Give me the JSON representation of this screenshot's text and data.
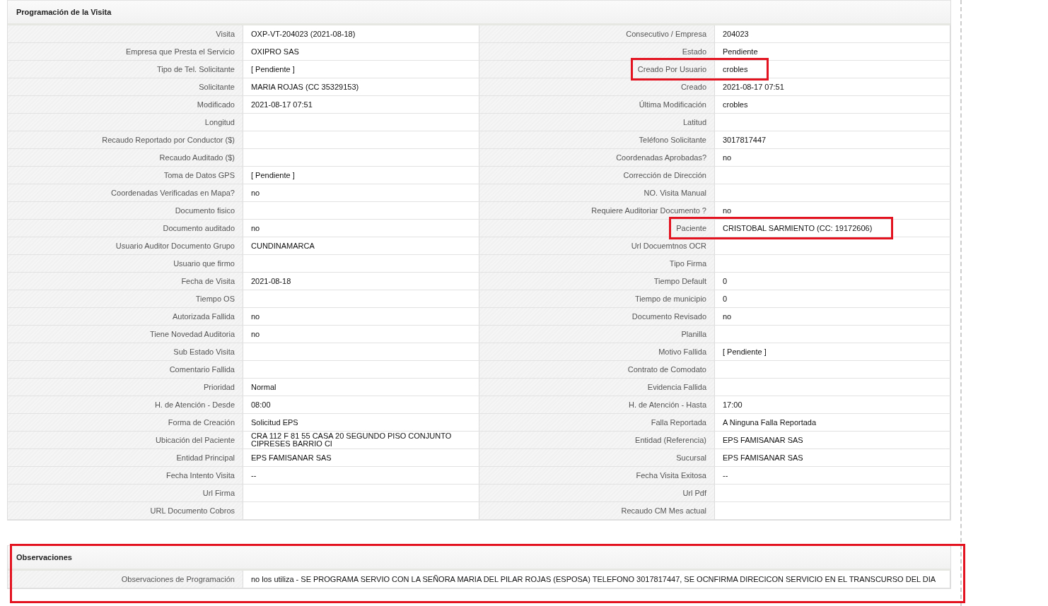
{
  "sections": [
    {
      "title": "Programación de la Visita",
      "highlighted": false,
      "rows": [
        {
          "left": {
            "label": "Visita",
            "value": "OXP-VT-204023 (2021-08-18)",
            "highlighted": false
          },
          "right": {
            "label": "Consecutivo / Empresa",
            "value": "204023",
            "highlighted": false
          }
        },
        {
          "left": {
            "label": "Empresa que Presta el Servicio",
            "value": "OXIPRO SAS",
            "highlighted": false
          },
          "right": {
            "label": "Estado",
            "value": "Pendiente",
            "highlighted": false
          }
        },
        {
          "left": {
            "label": "Tipo de Tel. Solicitante",
            "value": "[ Pendiente ]",
            "highlighted": false
          },
          "right": {
            "label": "Creado Por Usuario",
            "value": "crobles",
            "highlighted": true
          }
        },
        {
          "left": {
            "label": "Solicitante",
            "value": "MARIA ROJAS (CC 35329153)",
            "highlighted": false
          },
          "right": {
            "label": "Creado",
            "value": "2021-08-17 07:51",
            "highlighted": false
          }
        },
        {
          "left": {
            "label": "Modificado",
            "value": "2021-08-17 07:51",
            "highlighted": false
          },
          "right": {
            "label": "Última Modificación",
            "value": "crobles",
            "highlighted": false
          }
        },
        {
          "left": {
            "label": "Longitud",
            "highlighted": false
          },
          "right": {
            "label": "Latitud",
            "highlighted": false
          }
        },
        {
          "left": {
            "label": "Recaudo Reportado por Conductor ($)",
            "highlighted": false
          },
          "right": {
            "label": "Teléfono Solicitante",
            "value": "3017817447",
            "highlighted": false
          }
        },
        {
          "left": {
            "label": "Recaudo Auditado ($)",
            "highlighted": false
          },
          "right": {
            "label": "Coordenadas Aprobadas?",
            "value": "no",
            "highlighted": false
          }
        },
        {
          "left": {
            "label": "Toma de Datos GPS",
            "value": "[ Pendiente ]",
            "highlighted": false
          },
          "right": {
            "label": "Corrección de Dirección",
            "highlighted": false
          }
        },
        {
          "left": {
            "label": "Coordenadas Verificadas en Mapa?",
            "value": "no",
            "highlighted": false
          },
          "right": {
            "label": "NO. Visita Manual",
            "highlighted": false
          }
        },
        {
          "left": {
            "label": "Documento fisico",
            "highlighted": false
          },
          "right": {
            "label": "Requiere Auditoriar Documento ?",
            "value": "no",
            "highlighted": false
          }
        },
        {
          "left": {
            "label": "Documento auditado",
            "value": "no",
            "highlighted": false
          },
          "right": {
            "label": "Paciente",
            "value": "CRISTOBAL SARMIENTO (CC: 19172606)",
            "highlighted": true
          }
        },
        {
          "left": {
            "label": "Usuario Auditor Documento Grupo",
            "value": "CUNDINAMARCA",
            "highlighted": false
          },
          "right": {
            "label": "Url Docuemtnos OCR",
            "highlighted": false
          }
        },
        {
          "left": {
            "label": "Usuario que firmo",
            "highlighted": false
          },
          "right": {
            "label": "Tipo Firma",
            "highlighted": false
          }
        },
        {
          "left": {
            "label": "Fecha de Visita",
            "value": "2021-08-18",
            "highlighted": false
          },
          "right": {
            "label": "Tiempo Default",
            "value": "0",
            "highlighted": false
          }
        },
        {
          "left": {
            "label": "Tiempo OS",
            "highlighted": false
          },
          "right": {
            "label": "Tiempo de municipio",
            "value": "0",
            "highlighted": false
          }
        },
        {
          "left": {
            "label": "Autorizada Fallida",
            "value": "no",
            "highlighted": false
          },
          "right": {
            "label": "Documento Revisado",
            "value": "no",
            "highlighted": false
          }
        },
        {
          "left": {
            "label": "Tiene Novedad Auditoria",
            "value": "no",
            "highlighted": false
          },
          "right": {
            "label": "Planilla",
            "highlighted": false
          }
        },
        {
          "left": {
            "label": "Sub Estado Visita",
            "highlighted": false
          },
          "right": {
            "label": "Motivo Fallida",
            "value": "[ Pendiente ]",
            "highlighted": false
          }
        },
        {
          "left": {
            "label": "Comentario Fallida",
            "highlighted": false
          },
          "right": {
            "label": "Contrato de Comodato",
            "highlighted": false
          }
        },
        {
          "left": {
            "label": "Prioridad",
            "value": "Normal",
            "highlighted": false
          },
          "right": {
            "label": "Evidencia Fallida",
            "highlighted": false
          }
        },
        {
          "left": {
            "label": "H. de Atención - Desde",
            "value": "08:00",
            "highlighted": false
          },
          "right": {
            "label": "H. de Atención - Hasta",
            "value": "17:00",
            "highlighted": false
          }
        },
        {
          "left": {
            "label": "Forma de Creación",
            "value": "Solicitud EPS",
            "highlighted": false
          },
          "right": {
            "label": "Falla Reportada",
            "value": "A Ninguna Falla Reportada",
            "highlighted": false
          }
        },
        {
          "left": {
            "label": "Ubicación del Paciente",
            "value": "CRA 112 F 81 55 CASA 20 SEGUNDO PISO CONJUNTO CIPRESES BARRIO CI",
            "highlighted": false
          },
          "right": {
            "label": "Entidad (Referencia)",
            "value": "EPS FAMISANAR SAS",
            "highlighted": false
          }
        },
        {
          "left": {
            "label": "Entidad Principal",
            "value": "EPS FAMISANAR SAS",
            "highlighted": false
          },
          "right": {
            "label": "Sucursal",
            "value": "EPS FAMISANAR SAS",
            "highlighted": false
          }
        },
        {
          "left": {
            "label": "Fecha Intento Visita",
            "value": "--",
            "highlighted": false
          },
          "right": {
            "label": "Fecha Visita Exitosa",
            "value": "--",
            "highlighted": false
          }
        },
        {
          "left": {
            "label": "Url Firma",
            "highlighted": false
          },
          "right": {
            "label": "Url Pdf",
            "highlighted": false
          }
        },
        {
          "left": {
            "label": "URL Documento Cobros",
            "highlighted": false
          },
          "right": {
            "label": "Recaudo CM Mes actual",
            "highlighted": false
          }
        }
      ]
    },
    {
      "title": "Observaciones",
      "highlighted": true,
      "rows": [
        {
          "full": {
            "label": "Observaciones de Programación",
            "value": "no los utiliza - SE PROGRAMA SERVIO CON LA SEÑORA MARIA DEL PILAR ROJAS (ESPOSA) TELEFONO 3017817447, SE OCNFIRMA DIRECICON SERVICIO EN EL TRANSCURSO DEL DIA",
            "highlighted": false
          }
        }
      ]
    }
  ]
}
